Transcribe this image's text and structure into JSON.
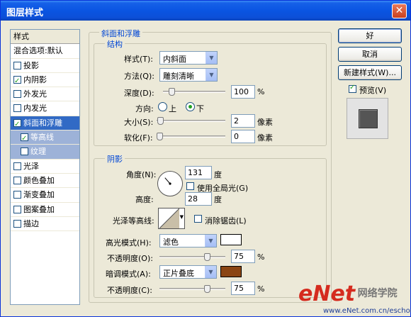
{
  "window": {
    "title": "图层样式",
    "close_glyph": "✕"
  },
  "style_list": {
    "header": "样式",
    "blend_options": "混合选项:默认",
    "items": [
      {
        "label": "投影",
        "checked": false
      },
      {
        "label": "内阴影",
        "checked": true
      },
      {
        "label": "外发光",
        "checked": false
      },
      {
        "label": "内发光",
        "checked": false
      },
      {
        "label": "斜面和浮雕",
        "checked": true,
        "selected": true
      },
      {
        "label": "等高线",
        "checked": true,
        "sub": true
      },
      {
        "label": "纹理",
        "checked": false,
        "sub": true
      },
      {
        "label": "光泽",
        "checked": false
      },
      {
        "label": "颜色叠加",
        "checked": false
      },
      {
        "label": "渐变叠加",
        "checked": false
      },
      {
        "label": "图案叠加",
        "checked": false
      },
      {
        "label": "描边",
        "checked": false
      }
    ]
  },
  "bevel": {
    "group_title": "斜面和浮雕",
    "structure_title": "结构",
    "style_label": "样式(T):",
    "style_value": "内斜面",
    "technique_label": "方法(Q):",
    "technique_value": "雕刻清晰",
    "depth_label": "深度(D):",
    "depth_value": "100",
    "depth_unit": "%",
    "depth_level": 0.1,
    "direction_label": "方向:",
    "direction_up": "上",
    "direction_down": "下",
    "direction_selected": "下",
    "size_label": "大小(S):",
    "size_value": "2",
    "size_unit": "像素",
    "size_level": 0.01,
    "soften_label": "软化(F):",
    "soften_value": "0",
    "soften_unit": "像素",
    "soften_level": 0.0
  },
  "shading": {
    "title": "阴影",
    "angle_label": "角度(N):",
    "angle_value": "131",
    "angle_unit": "度",
    "global_light_label": "使用全局光(G)",
    "global_light_checked": false,
    "altitude_label": "高度:",
    "altitude_value": "28",
    "altitude_unit": "度",
    "gloss_contour_label": "光泽等高线:",
    "antialias_label": "消除锯齿(L)",
    "antialias_checked": false,
    "highlight_mode_label": "高光模式(H):",
    "highlight_mode_value": "滤色",
    "highlight_color": "#FFFFFF",
    "highlight_opacity_label": "不透明度(O):",
    "highlight_opacity_value": "75",
    "highlight_opacity_unit": "%",
    "highlight_opacity_level": 0.75,
    "shadow_mode_label": "暗调模式(A):",
    "shadow_mode_value": "正片叠底",
    "shadow_color": "#8B4513",
    "shadow_opacity_label": "不透明度(C):",
    "shadow_opacity_value": "75",
    "shadow_opacity_unit": "%",
    "shadow_opacity_level": 0.75
  },
  "buttons": {
    "ok": "好",
    "cancel": "取消",
    "new_style": "新建样式(W)...",
    "preview_label": "预览(V)",
    "preview_checked": true
  },
  "watermark": {
    "brand": "eNet",
    "brand_cn": "网络学院",
    "url": "www.eNet.com.cn/eschool"
  },
  "colors": {
    "accent": "#0046D5",
    "selection": "#316AC5",
    "titlebar": "#0A55E2"
  }
}
